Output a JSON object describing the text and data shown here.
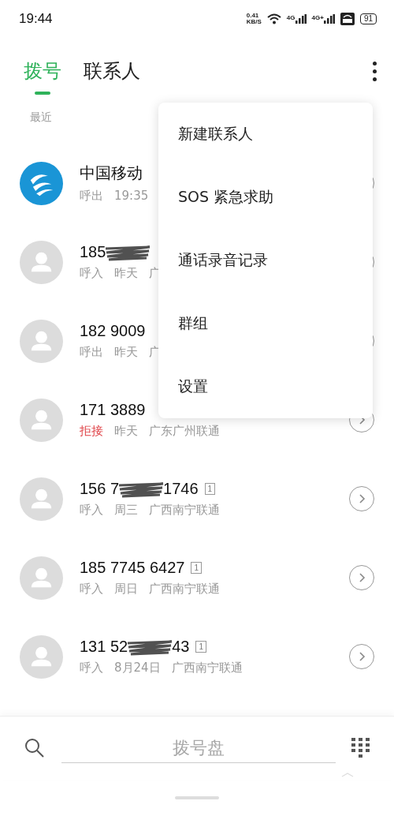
{
  "status_bar": {
    "time": "19:44",
    "speed_value": "0.41",
    "speed_unit": "KB/S",
    "networks": [
      "4G",
      "4G+"
    ],
    "battery": "91"
  },
  "tabs": [
    {
      "label": "拨号",
      "selected": true
    },
    {
      "label": "联系人",
      "selected": false
    }
  ],
  "section": "最近",
  "calls": [
    {
      "kind": "operator",
      "name_parts": [
        "中国移动"
      ],
      "redacted": false,
      "call_type": "呼出",
      "rejected": false,
      "time": "19:35"
    },
    {
      "kind": "person",
      "name_parts": [
        "185"
      ],
      "redacted": true,
      "call_type": "呼入",
      "rejected": false,
      "time": "昨天",
      "location": "广"
    },
    {
      "kind": "person",
      "name_parts": [
        "182 9009"
      ],
      "redacted": false,
      "call_type": "呼出",
      "rejected": false,
      "time": "昨天",
      "location": "广"
    },
    {
      "kind": "person",
      "name_parts": [
        "171 3889"
      ],
      "redacted": false,
      "call_type": "拒接",
      "rejected": true,
      "time": "昨天",
      "location": "广东广州联通"
    },
    {
      "kind": "person",
      "name_parts": [
        "156 7",
        "1746"
      ],
      "redacted": true,
      "call_type": "呼入",
      "rejected": false,
      "time": "周三",
      "location": "广西南宁联通",
      "sim": "1"
    },
    {
      "kind": "person",
      "name_parts": [
        "185 7745 6427"
      ],
      "redacted": false,
      "call_type": "呼入",
      "rejected": false,
      "time": "周日",
      "location": "广西南宁联通",
      "sim": "1"
    },
    {
      "kind": "person",
      "name_parts": [
        "131 52",
        "43"
      ],
      "redacted": true,
      "call_type": "呼入",
      "rejected": false,
      "time": "8月24日",
      "location": "广西南宁联通",
      "sim": "1"
    }
  ],
  "menu": {
    "items": [
      "新建联系人",
      "SOS 紧急求助",
      "通话录音记录",
      "群组",
      "设置"
    ]
  },
  "dialer": {
    "placeholder": "拨号盘"
  }
}
